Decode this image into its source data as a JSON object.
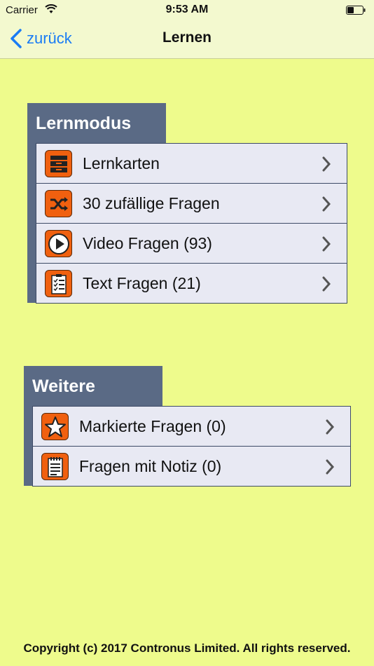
{
  "status": {
    "carrier": "Carrier",
    "time": "9:53 AM"
  },
  "nav": {
    "back_label": "zurück",
    "title": "Lernen"
  },
  "sections": [
    {
      "title": "Lernmodus",
      "items": [
        {
          "label": "Lernkarten",
          "icon": "card-box-icon"
        },
        {
          "label": "30 zufällige Fragen",
          "icon": "shuffle-icon"
        },
        {
          "label": "Video Fragen (93)",
          "icon": "play-icon"
        },
        {
          "label": "Text Fragen (21)",
          "icon": "checklist-icon"
        }
      ]
    },
    {
      "title": "Weitere",
      "items": [
        {
          "label": "Markierte Fragen (0)",
          "icon": "star-icon"
        },
        {
          "label": "Fragen mit Notiz (0)",
          "icon": "note-icon"
        }
      ]
    }
  ],
  "footer": {
    "copyright": "Copyright (c) 2017 Contronus Limited. All rights reserved."
  },
  "colors": {
    "background": "#eefb8c",
    "panel": "#5a6a85",
    "list": "#e8e9f3",
    "icon": "#f0600f",
    "link": "#1a7cf4"
  }
}
